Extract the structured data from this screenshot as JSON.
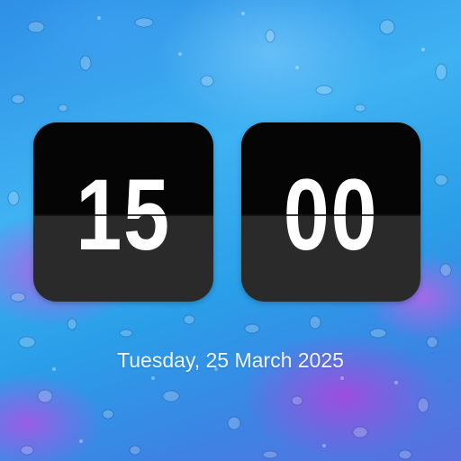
{
  "clock": {
    "hours": "15",
    "minutes": "00"
  },
  "date": {
    "label": "Tuesday, 25 March 2025"
  },
  "wallpaper": {
    "description_icon": "water-droplets-wallpaper",
    "colors": {
      "primary": "#3fb2f2",
      "secondary": "#2f8fe6",
      "accent": "#d050e6"
    }
  },
  "card_colors": {
    "top": "#050505",
    "bottom": "#2a2a2a",
    "digit": "#ffffff"
  }
}
